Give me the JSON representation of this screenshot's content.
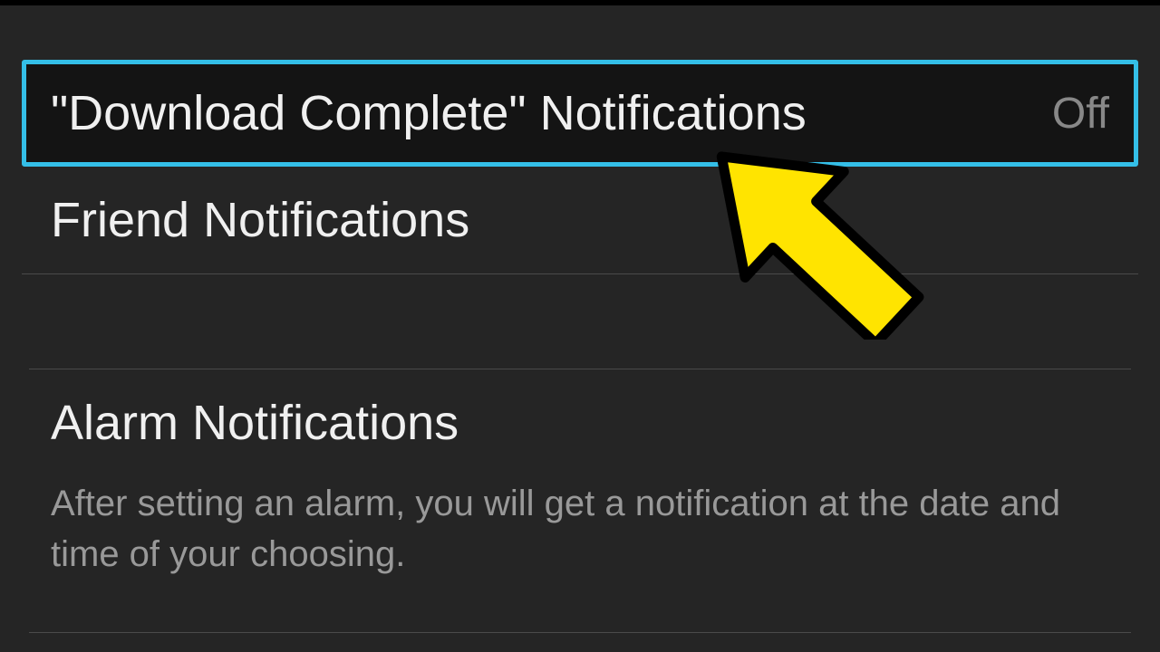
{
  "settings": {
    "download_complete": {
      "label": "\"Download Complete\" Notifications",
      "value": "Off"
    },
    "friend_notifications": {
      "label": "Friend Notifications"
    }
  },
  "alarm_section": {
    "heading": "Alarm Notifications",
    "description": "After setting an alarm, you will get a notification at the date and time of your choosing."
  }
}
